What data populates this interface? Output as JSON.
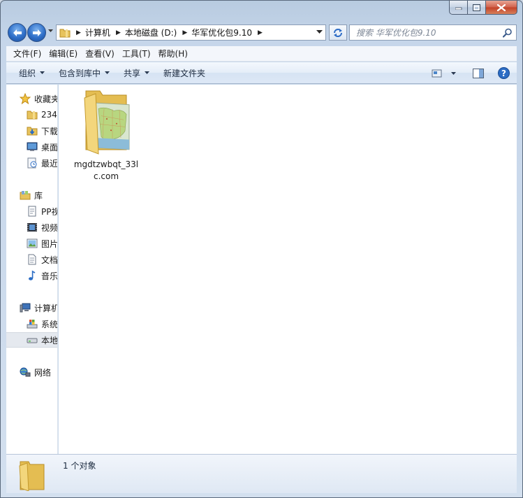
{
  "window": {
    "controls": {
      "minimize_icon": "minimize-icon",
      "maximize_icon": "maximize-icon",
      "close_icon": "close-icon"
    }
  },
  "address_bar": {
    "breadcrumbs": [
      "计算机",
      "本地磁盘 (D:)",
      "华军优化包9.10"
    ]
  },
  "search": {
    "placeholder": "搜索 华军优化包9.10"
  },
  "menubar": {
    "items": [
      "文件(F)",
      "编辑(E)",
      "查看(V)",
      "工具(T)",
      "帮助(H)"
    ]
  },
  "toolbar": {
    "organize": "组织",
    "include_in_library": "包含到库中",
    "share": "共享",
    "new_folder": "新建文件夹"
  },
  "navpane": {
    "favorites": {
      "label": "收藏夹",
      "items": [
        "234",
        "下载",
        "桌面",
        "最近"
      ]
    },
    "libraries": {
      "label": "库",
      "items": [
        "PP视",
        "视频",
        "图片",
        "文档",
        "音乐"
      ]
    },
    "computer": {
      "label": "计算机",
      "items": [
        "系统",
        "本地"
      ]
    },
    "network": {
      "label": "网络"
    }
  },
  "content": {
    "files": [
      {
        "name": "mgdtzwbqt_33lc.com",
        "icon": "map-folder-icon"
      }
    ]
  },
  "details": {
    "count": "1 个对象"
  }
}
